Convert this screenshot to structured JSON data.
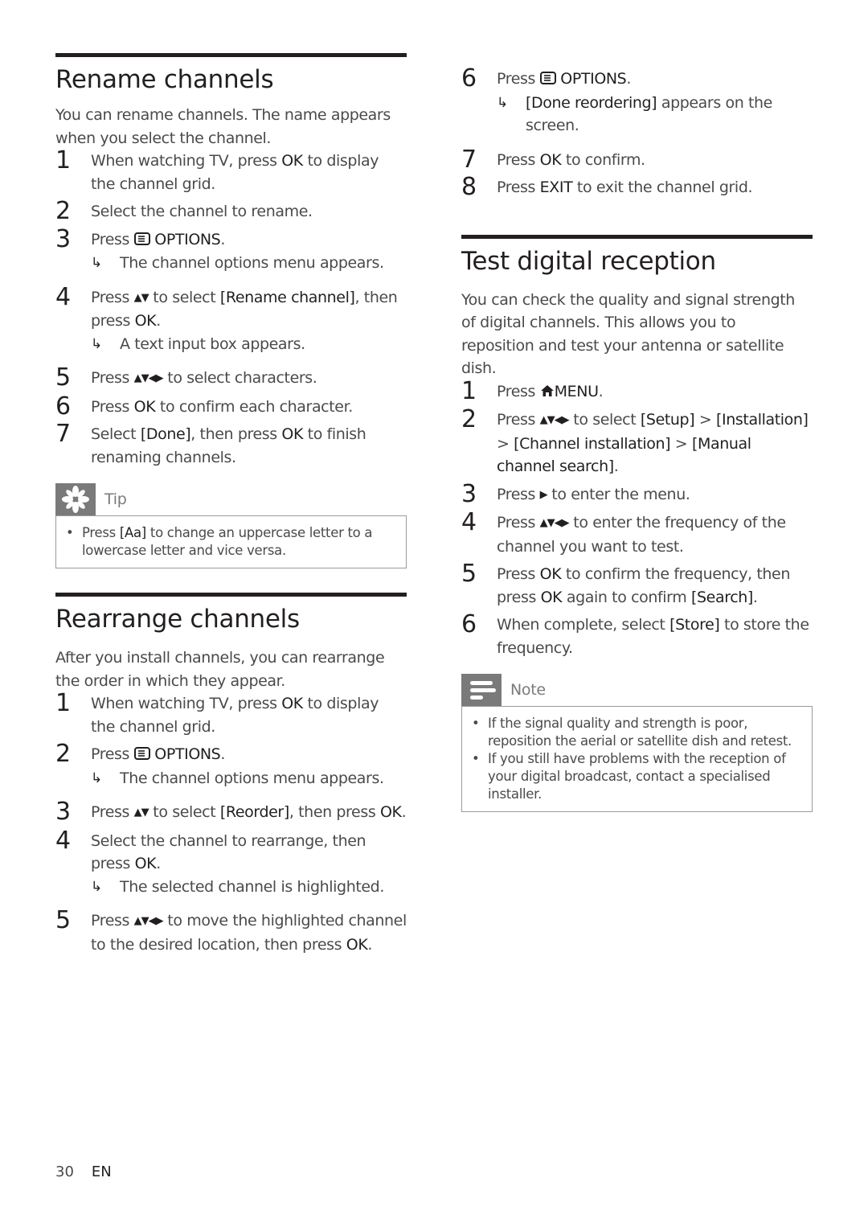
{
  "rename": {
    "title": "Rename channels",
    "intro": "You can rename channels. The name appears when you select the channel.",
    "steps": [
      {
        "num": "1",
        "parts": [
          "When watching TV, press ",
          "OK",
          " to display the channel grid."
        ]
      },
      {
        "num": "2",
        "text": "Select the channel to rename."
      },
      {
        "num": "3",
        "pre": "Press ",
        "key": "OPTIONS",
        "post": ".",
        "result": "The channel options menu appears."
      },
      {
        "num": "4",
        "pre": "Press ",
        "arrows": "▲▼",
        "mid": " to select ",
        "kw": "[Rename channel]",
        "post1": ", then press ",
        "kw2": "OK",
        "post2": ".",
        "result": "A text input box appears."
      },
      {
        "num": "5",
        "pre": "Press ",
        "arrows": "▲▼◀▶",
        "post": " to select characters."
      },
      {
        "num": "6",
        "pre": "Press ",
        "kw": "OK",
        "post": " to confirm each character."
      },
      {
        "num": "7",
        "pre": "Select ",
        "kw": "[Done]",
        "mid": ", then press ",
        "kw2": "OK",
        "post": " to finish renaming channels."
      }
    ],
    "tip": {
      "label": "Tip",
      "icon": "asterisk-icon",
      "items": [
        {
          "pre": "Press ",
          "kw": "[Aa]",
          "post": " to change an uppercase letter to a lowercase letter and vice versa."
        }
      ]
    }
  },
  "rearrange": {
    "title": "Rearrange channels",
    "intro": "After you install channels, you can rearrange the order in which they appear.",
    "steps": [
      {
        "num": "1",
        "pre": "When watching TV, press ",
        "kw": "OK",
        "post": " to display the channel grid."
      },
      {
        "num": "2",
        "pre": "Press ",
        "key": "OPTIONS",
        "post": ".",
        "result": "The channel options menu appears."
      },
      {
        "num": "3",
        "pre": "Press ",
        "arrows": "▲▼",
        "mid": " to select ",
        "kw": "[Reorder]",
        "mid2": ", then press ",
        "kw2": "OK",
        "post": "."
      },
      {
        "num": "4",
        "pre": "Select the channel to rearrange, then press ",
        "kw": "OK",
        "post": ".",
        "result": "The selected channel is highlighted."
      },
      {
        "num": "5",
        "pre": "Press ",
        "arrows": "▲▼◀▶",
        "mid": " to move the highlighted channel to the desired location, then press ",
        "kw": "OK",
        "post": "."
      },
      {
        "num": "6",
        "pre": "Press ",
        "key": "OPTIONS",
        "post": ".",
        "result_kw": "[Done reordering]",
        "result": " appears on the screen."
      },
      {
        "num": "7",
        "pre": "Press ",
        "kw": "OK",
        "post": " to confirm."
      },
      {
        "num": "8",
        "pre": "Press ",
        "kw": "EXIT",
        "post": " to exit the channel grid."
      }
    ]
  },
  "test": {
    "title": "Test digital reception",
    "intro": "You can check the quality and signal strength of digital channels. This allows you to reposition and test your antenna or satellite dish.",
    "steps": [
      {
        "num": "1",
        "pre": "Press ",
        "key": "MENU",
        "post": "."
      },
      {
        "num": "2",
        "pre": "Press ",
        "arrows": "▲▼◀▶",
        "mid": " to select ",
        "kw": "[Setup]",
        "sep1": " > ",
        "kw2": "[Installation]",
        "sep2": " > ",
        "kw3": "[Channel installation]",
        "sep3": " > ",
        "kw4": "[Manual channel search]",
        "post": "."
      },
      {
        "num": "3",
        "pre": "Press ",
        "arrows": "▶",
        "post": " to enter the menu."
      },
      {
        "num": "4",
        "pre": "Press ",
        "arrows": "▲▼◀▶",
        "post": " to enter the frequency of the channel you want to test."
      },
      {
        "num": "5",
        "pre": "Press ",
        "kw": "OK",
        "mid": " to confirm the frequency, then press ",
        "kw2": "OK",
        "mid2": " again to confirm ",
        "kw3": "[Search]",
        "post": "."
      },
      {
        "num": "6",
        "pre": "When complete, select ",
        "kw": "[Store]",
        "post": " to store the frequency."
      }
    ],
    "note": {
      "label": "Note",
      "icon": "note-lines-icon",
      "items": [
        "If the signal quality and strength is poor, reposition the aerial or satellite dish and retest.",
        "If you still have problems with the reception of your digital broadcast, contact a specialised installer."
      ]
    }
  },
  "footer": {
    "page": "30",
    "lang": "EN"
  },
  "icons": {
    "result": "↳",
    "options": "options-button-icon",
    "menu": "home-icon"
  }
}
